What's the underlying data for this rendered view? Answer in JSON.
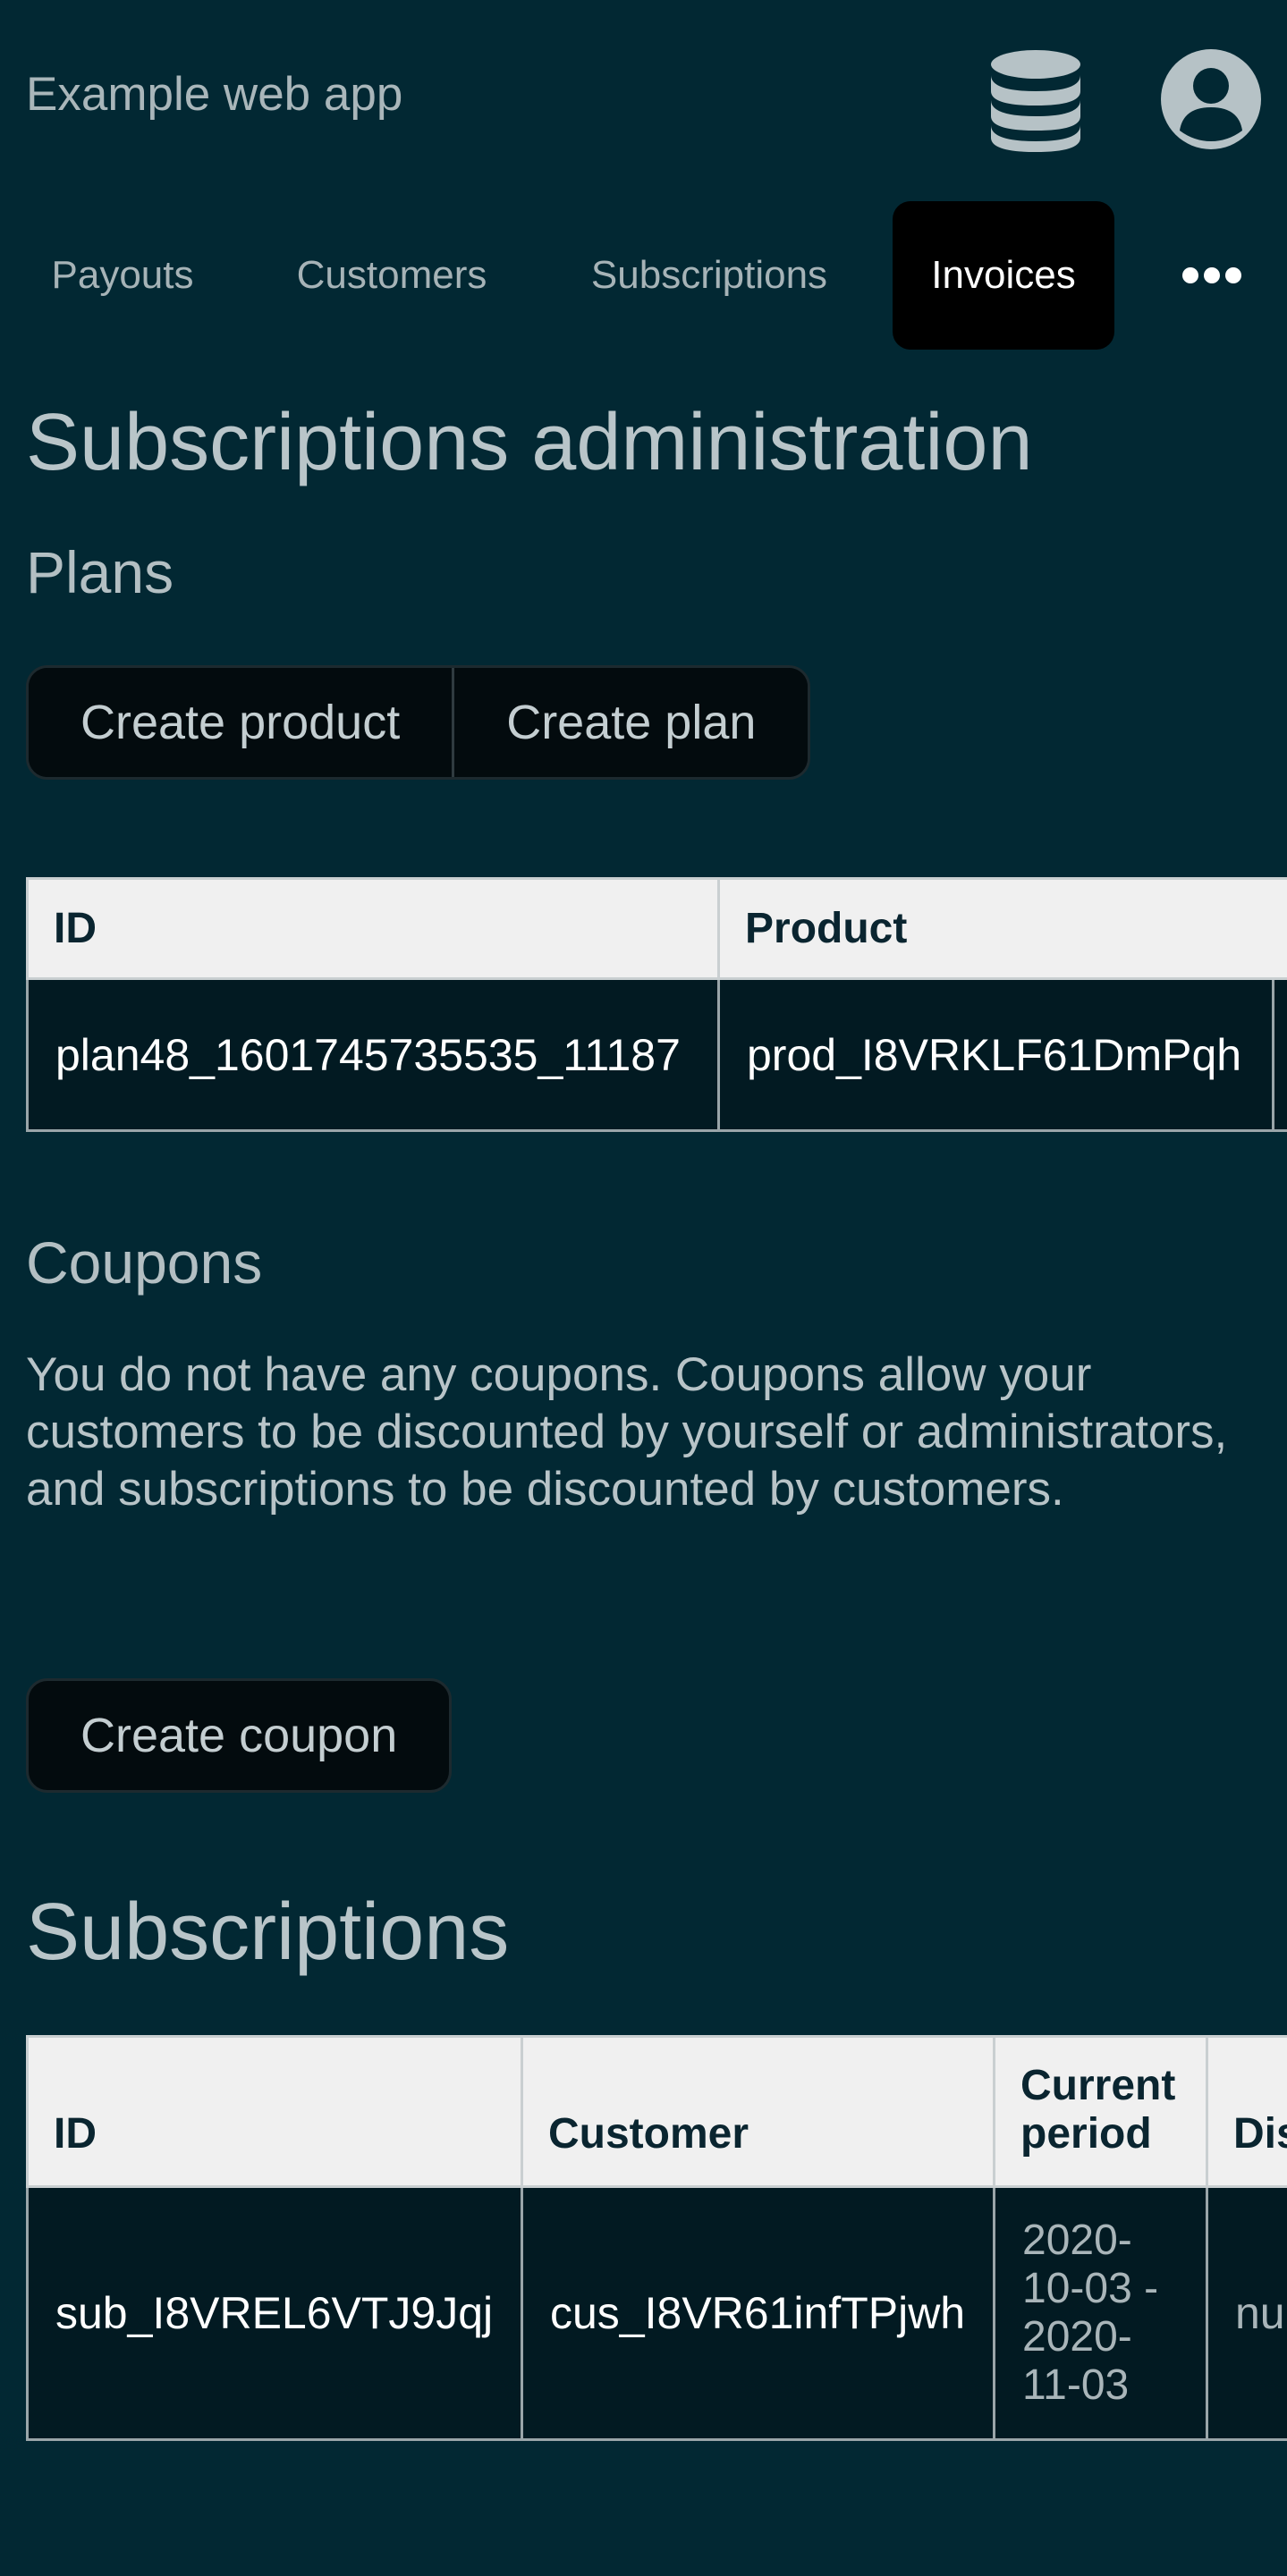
{
  "header": {
    "app_title": "Example web app",
    "icons": [
      "database-icon",
      "account-circle-icon"
    ]
  },
  "nav": {
    "tabs": [
      {
        "label": "Payouts",
        "active": false
      },
      {
        "label": "Customers",
        "active": false
      },
      {
        "label": "Subscriptions",
        "active": false
      },
      {
        "label": "Invoices",
        "active": true
      }
    ],
    "more_icon": "more-horizontal-icon"
  },
  "main": {
    "page_title": "Subscriptions administration",
    "plans": {
      "heading": "Plans",
      "buttons": {
        "create_product": "Create product",
        "create_plan": "Create plan"
      },
      "table": {
        "columns": [
          "ID",
          "Product"
        ],
        "rows": [
          {
            "id": "plan48_1601745735535_11187",
            "product": "prod_I8VRKLF61DmPqh"
          }
        ]
      }
    },
    "coupons": {
      "heading": "Coupons",
      "description": "You do not have any coupons. Coupons allow your customers to be discounted by yourself or administrators, and subscriptions to be discounted by customers.",
      "create_button": "Create coupon"
    },
    "subscriptions": {
      "heading": "Subscriptions",
      "table": {
        "columns": [
          "ID",
          "Customer",
          "Current period",
          "Dis"
        ],
        "rows": [
          {
            "id": "sub_I8VREL6VTJ9Jqj",
            "customer": "cus_I8VR61infTPjwh",
            "current_period": "2020-10-03 - 2020-11-03",
            "discount": "nu"
          }
        ]
      }
    }
  },
  "colors": {
    "background": "#022833",
    "active_tab": "#000000",
    "table_header": "#f0f0f0",
    "table_cell": "#021a22"
  }
}
